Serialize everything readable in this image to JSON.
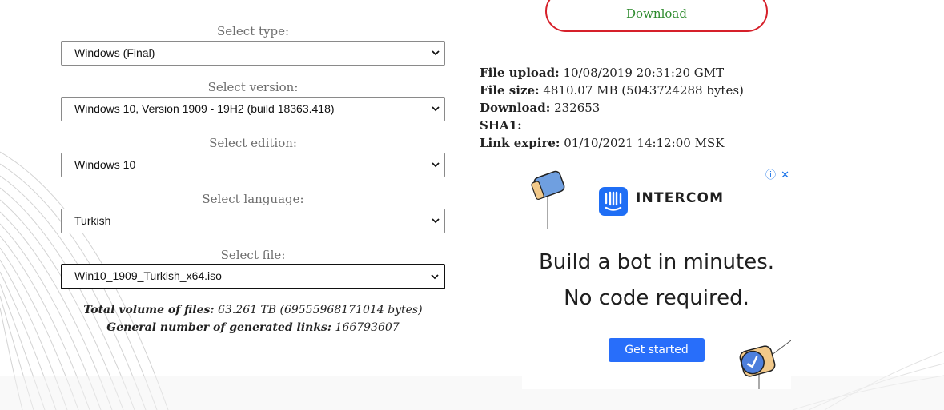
{
  "download": {
    "label": "Download"
  },
  "form": {
    "type": {
      "label": "Select type:",
      "value": "Windows (Final)"
    },
    "version": {
      "label": "Select version:",
      "value": "Windows 10, Version 1909 - 19H2 (build 18363.418)"
    },
    "edition": {
      "label": "Select edition:",
      "value": "Windows 10"
    },
    "language": {
      "label": "Select language:",
      "value": "Turkish"
    },
    "file": {
      "label": "Select file:",
      "value": "Win10_1909_Turkish_x64.iso"
    }
  },
  "stats": {
    "volume_label": "Total volume of files:",
    "volume_value": "63.261 TB (69555968171014 bytes)",
    "links_label": "General number of generated links:",
    "links_value": "166793607"
  },
  "info": {
    "upload_label": "File upload:",
    "upload_value": "10/08/2019 20:31:20 GMT",
    "size_label": "File size:",
    "size_value": "4810.07 MB (5043724288 bytes)",
    "download_label": "Download:",
    "download_value": "232653",
    "sha1_label": "SHA1:",
    "sha1_value": "",
    "expire_label": "Link expire:",
    "expire_value": "01/10/2021 14:12:00 MSK"
  },
  "ad": {
    "brand": "INTERCOM",
    "headline_line1": "Build a bot in minutes.",
    "headline_line2": "No code required.",
    "cta": "Get started",
    "info_icon": "ⓘ",
    "close_icon": "✕"
  },
  "colors": {
    "download_border": "#d6202a",
    "download_text": "#2e8b2e",
    "ad_cta": "#286efa",
    "ad_logo": "#1f6ef5"
  }
}
